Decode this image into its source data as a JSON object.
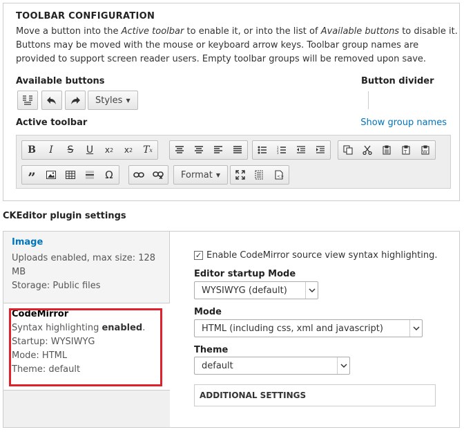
{
  "toolbar_config": {
    "title": "TOOLBAR CONFIGURATION",
    "desc_1": "Move a button into the ",
    "desc_em_1": "Active toolbar",
    "desc_2": " to enable it, or into the list of ",
    "desc_em_2": "Available buttons",
    "desc_3": " to disable it. Buttons may be moved with the mouse or keyboard arrow keys. Toolbar group names are provided to support screen reader users. Empty toolbar groups will be removed upon save.",
    "available_label": "Available buttons",
    "divider_label": "Button divider",
    "active_label": "Active toolbar",
    "show_group_names": "Show group names",
    "available_buttons": [
      {
        "icon": "source-icon"
      },
      {
        "icon": "undo-icon"
      },
      {
        "icon": "redo-icon"
      }
    ],
    "styles_combo": "Styles",
    "format_combo": "Format",
    "active_row1": {
      "basic": [
        "bold-icon",
        "italic-icon",
        "strikethrough-icon",
        "underline-icon",
        "superscript-icon",
        "subscript-icon",
        "remove-format-icon"
      ],
      "align": [
        "align-left-icon",
        "align-center-icon",
        "align-right-icon",
        "align-justify-icon"
      ],
      "lists": [
        "bulleted-list-icon",
        "numbered-list-icon",
        "outdent-icon",
        "indent-icon"
      ],
      "clipboard": [
        "copy-icon",
        "cut-icon",
        "paste-icon",
        "paste-text-icon",
        "paste-word-icon"
      ]
    },
    "active_row2": {
      "media": [
        "blockquote-icon",
        "image-icon",
        "table-icon",
        "horizontal-line-icon",
        "special-char-icon"
      ],
      "links": [
        "link-icon",
        "unlink-icon"
      ],
      "tools": [
        "maximize-icon",
        "show-blocks-icon",
        "source-code-icon"
      ]
    }
  },
  "plugin_settings": {
    "heading": "CKEditor plugin settings",
    "tabs": [
      {
        "title": "Image",
        "lines": [
          "Uploads enabled, max size: 128",
          "MB",
          "Storage: Public files"
        ]
      },
      {
        "title": "CodeMirror",
        "line1_prefix": "Syntax highlighting ",
        "line1_bold": "enabled",
        "line1_suffix": ".",
        "line2": "Startup: WYSIWYG",
        "line3": "Mode: HTML",
        "line4": "Theme: default"
      }
    ],
    "pane": {
      "checkbox_label": "Enable CodeMirror source view syntax highlighting.",
      "checkbox_checked": true,
      "startup_label": "Editor startup Mode",
      "startup_value": "WYSIWYG (default)",
      "mode_label": "Mode",
      "mode_value": "HTML (including css, xml and javascript)",
      "theme_label": "Theme",
      "theme_value": "default",
      "additional": "ADDITIONAL SETTINGS"
    }
  },
  "colors": {
    "link": "#0074bd",
    "highlight": "#e0202a"
  }
}
